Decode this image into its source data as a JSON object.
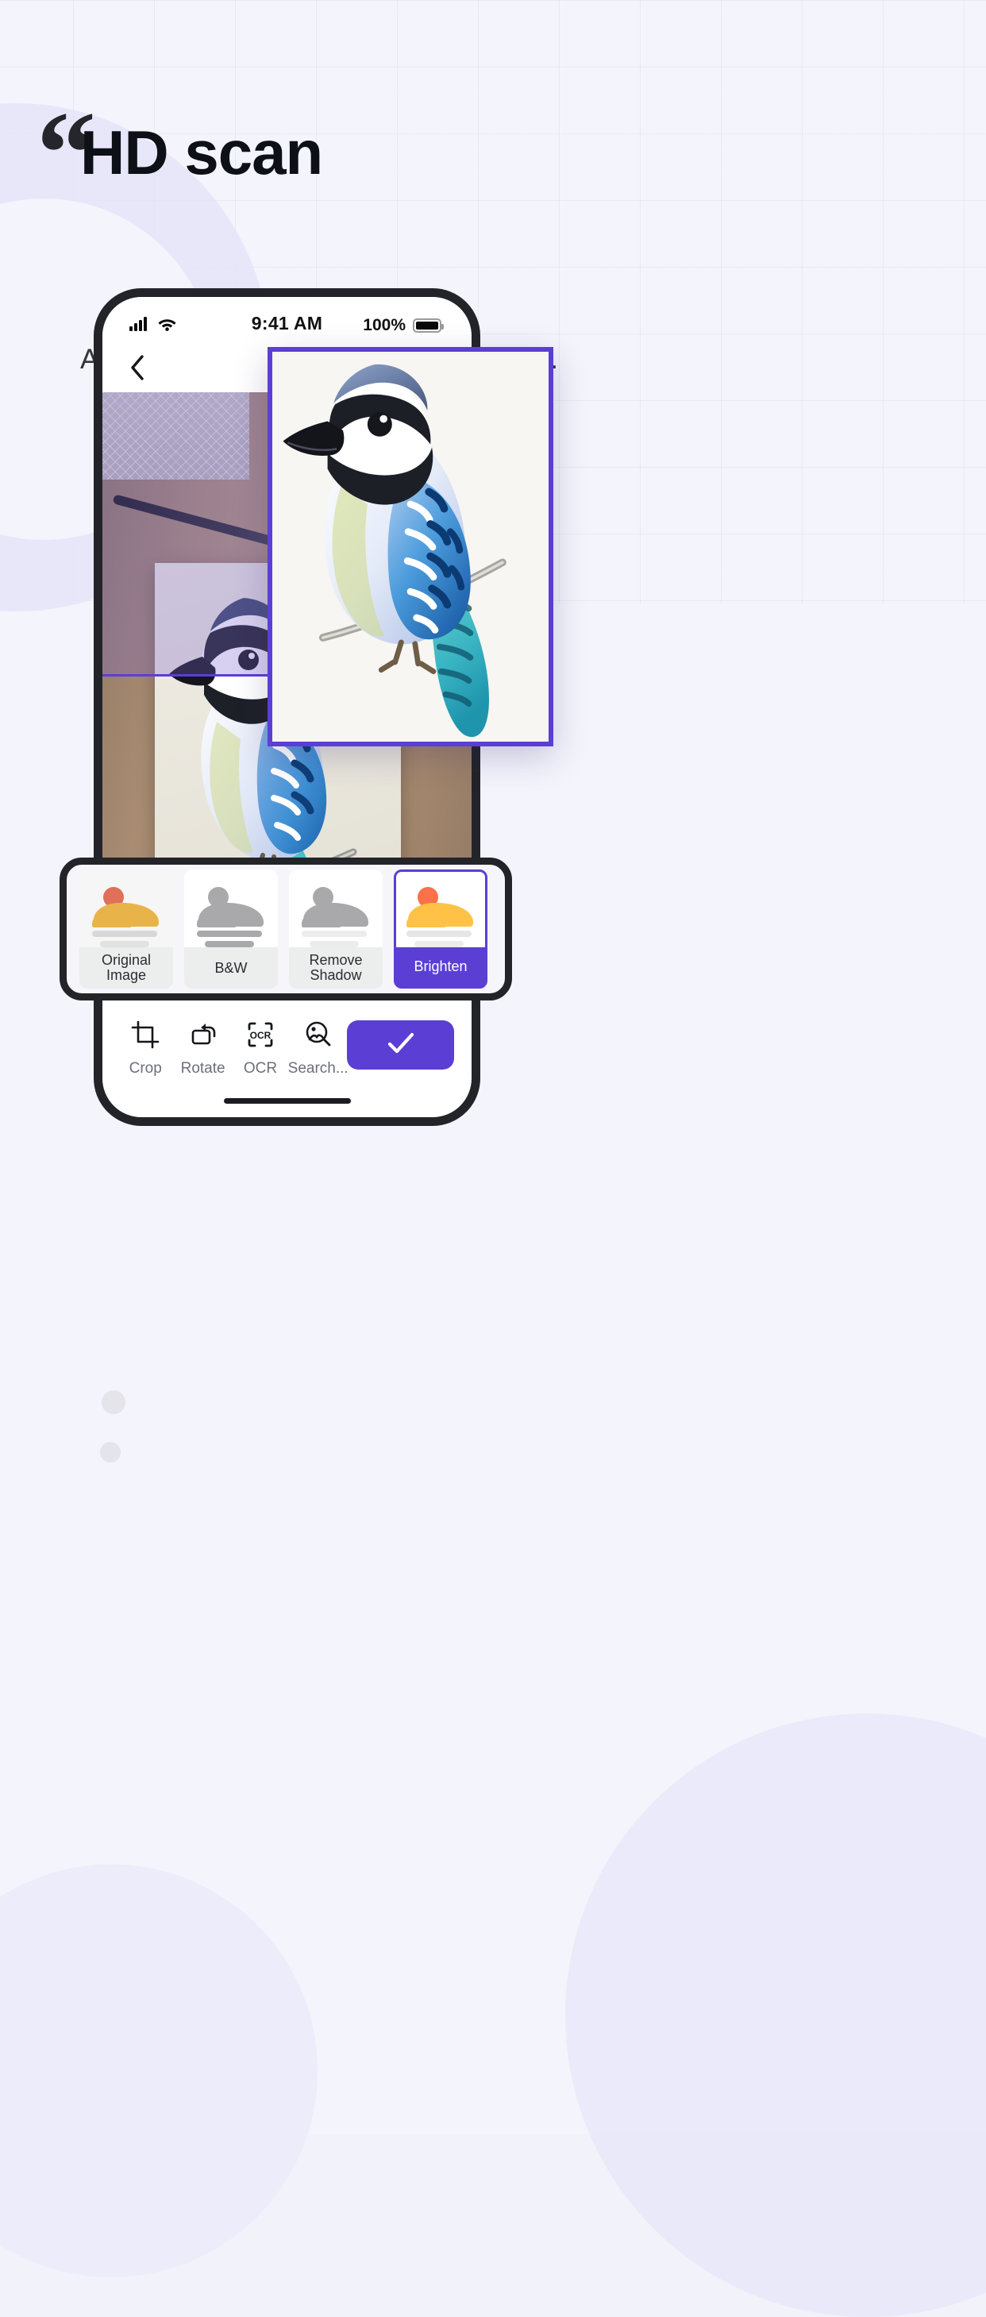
{
  "hero": {
    "quote_glyph": "“",
    "title": "HD scan",
    "subtitle": "Auto crop,keystone correction,filters,etc."
  },
  "phone": {
    "status_bar": {
      "signal_icon": "cellular-bars-icon",
      "wifi_icon": "wifi-icon",
      "time": "9:41 AM",
      "battery_percent": "100%",
      "battery_icon": "battery-full-icon"
    },
    "nav": {
      "back_icon": "chevron-left-icon"
    },
    "preview": {
      "border_color": "#5b3fd4",
      "subject": "blue-jay-colored-pencil-drawing"
    },
    "filters": {
      "items": [
        {
          "label": "Original Image",
          "icon": "image-placeholder-icon",
          "selected": false,
          "sun_color": "#e0705a",
          "hill_color": "#e8b košt"
        },
        {
          "label": "B&W",
          "icon": "image-placeholder-icon",
          "selected": false
        },
        {
          "label": "Remove Shadow",
          "icon": "image-placeholder-icon",
          "selected": false
        },
        {
          "label": "Brighten",
          "icon": "image-placeholder-icon",
          "selected": true
        }
      ]
    },
    "toolbar": {
      "tools": [
        {
          "label": "Crop",
          "icon": "crop-icon"
        },
        {
          "label": "Rotate",
          "icon": "rotate-icon"
        },
        {
          "label": "OCR",
          "icon": "ocr-scan-icon"
        },
        {
          "label": "Search...",
          "icon": "image-search-icon"
        }
      ],
      "confirm": {
        "icon": "check-icon",
        "color": "#5b3fd4"
      }
    }
  },
  "colors": {
    "accent": "#5b3fd4",
    "page_bg": "#f4f4fc",
    "title": "#0d1117",
    "subtitle": "#32343c",
    "sun_orange": "#e0705a",
    "hill_yellow": "#e8b44a",
    "gray_icon": "#a9a9ac",
    "bright_sun": "#fb7149",
    "bright_hill": "#ffc247"
  }
}
